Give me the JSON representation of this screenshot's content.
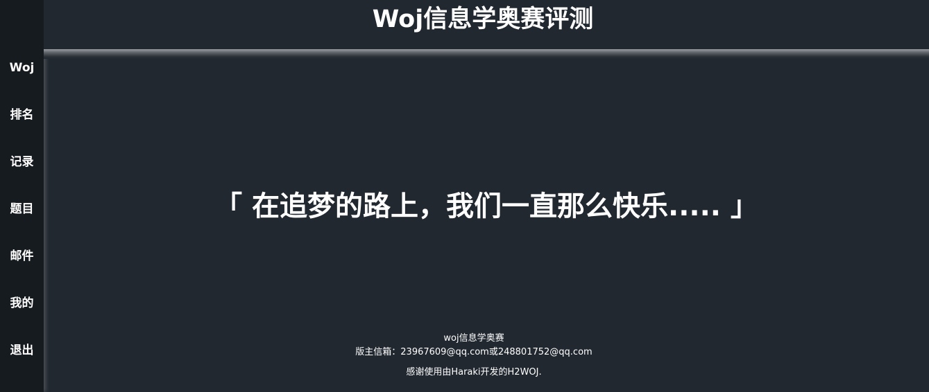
{
  "header": {
    "title": "Woj信息学奥赛评测"
  },
  "sidebar": {
    "items": [
      {
        "label": "Woj"
      },
      {
        "label": "排名"
      },
      {
        "label": "记录"
      },
      {
        "label": "题目"
      },
      {
        "label": "邮件"
      },
      {
        "label": "我的"
      },
      {
        "label": "退出"
      }
    ]
  },
  "main": {
    "motto": "「 在追梦的路上，我们一直那么快乐..... 」"
  },
  "footer": {
    "site_name": "woj信息学奥赛",
    "contact": "版主信箱：23967609@qq.com或248801752@qq.com",
    "credits": "感谢使用由Haraki开发的H2WOJ."
  },
  "colors": {
    "background": "#212830",
    "sidebar": "#161b20",
    "text": "#ffffff"
  }
}
